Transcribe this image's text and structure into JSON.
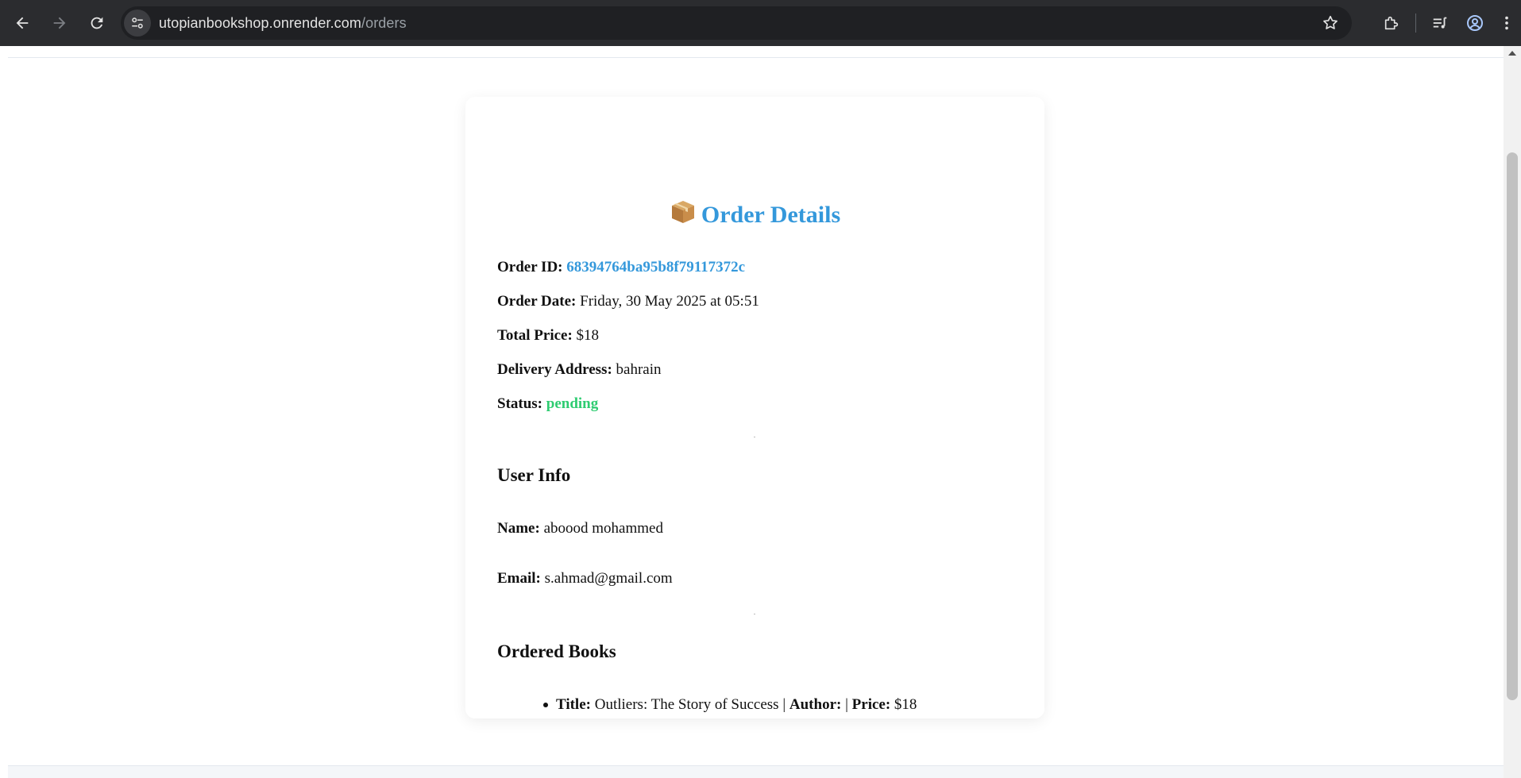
{
  "browser": {
    "url_host": "utopianbookshop.onrender.com",
    "url_path": "/orders"
  },
  "order": {
    "heading": "Order Details",
    "heading_icon": "package-icon",
    "id_label": "Order ID:",
    "id_value": "68394764ba95b8f79117372c",
    "date_label": "Order Date:",
    "date_value": "Friday, 30 May 2025 at 05:51",
    "total_label": "Total Price:",
    "total_value": "$18",
    "address_label": "Delivery Address:",
    "address_value": "bahrain",
    "status_label": "Status:",
    "status_value": "pending",
    "status_color": "#2ecc71",
    "accent_color": "#3498db"
  },
  "user": {
    "heading": "User Info",
    "name_label": "Name:",
    "name_value": "aboood mohammed",
    "email_label": "Email:",
    "email_value": "s.ahmad@gmail.com"
  },
  "books": {
    "heading": "Ordered Books",
    "items": [
      {
        "title_label": "Title:",
        "title_value": "Outliers: The Story of Success",
        "separator1": "|",
        "author_label": "Author:",
        "author_value": "",
        "separator2": "|",
        "price_label": "Price:",
        "price_value": "$18"
      }
    ]
  }
}
